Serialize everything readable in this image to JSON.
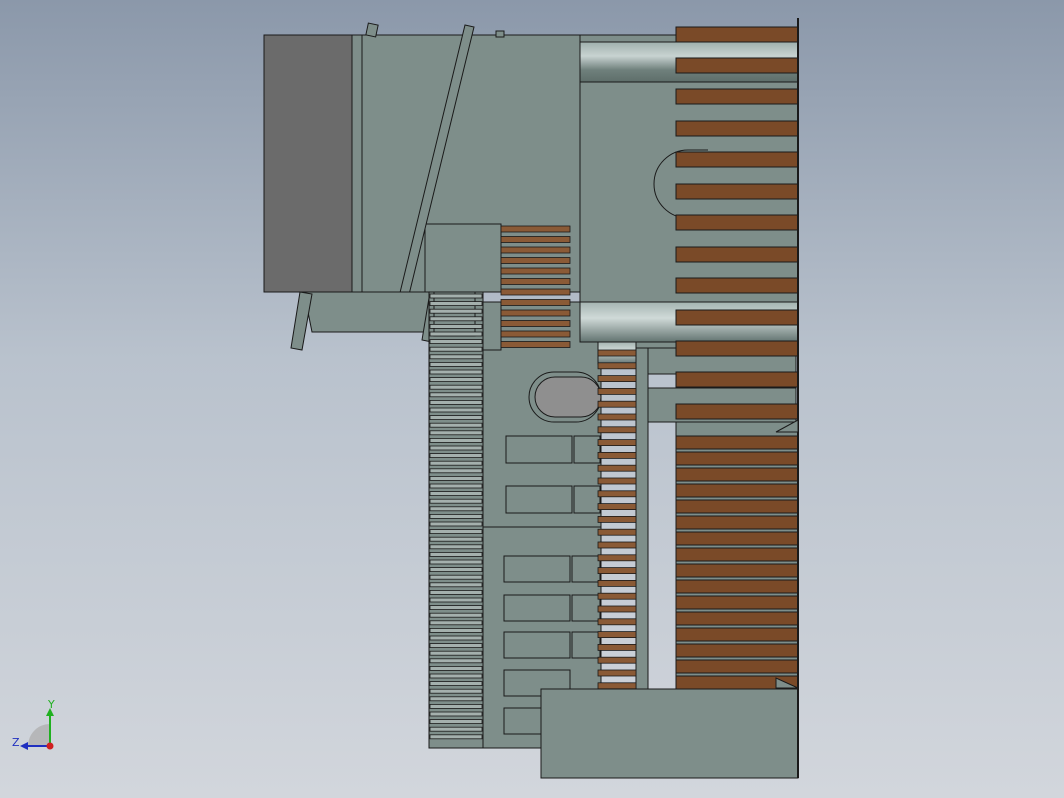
{
  "viewport": {
    "background_top": "#8b98aa",
    "background_bottom": "#d2d6dc"
  },
  "model": {
    "body_color": "#7e8e8a",
    "dark_block_color": "#6b6b6b",
    "fin_color": "#7a4a28",
    "edge_color": "#1a1a1a",
    "slot_color": "#8f9b97"
  },
  "triad": {
    "y_label": "Y",
    "z_label": "Z",
    "y_color": "#20b020",
    "z_color": "#2030c0",
    "x_color": "#d02020",
    "icon": "view-orientation-triad-icon"
  }
}
